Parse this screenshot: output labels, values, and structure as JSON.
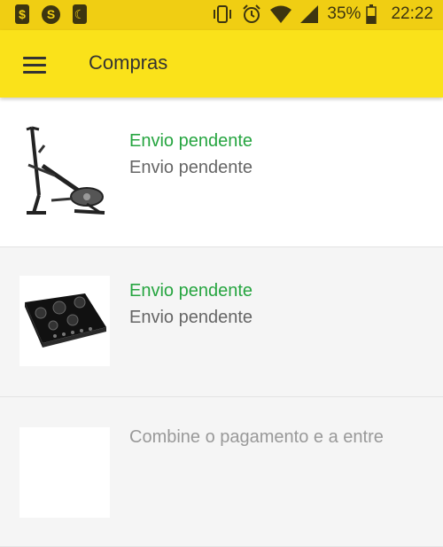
{
  "status_bar": {
    "battery": "35%",
    "time": "22:22",
    "notification_icons": [
      "dollar-notification-icon",
      "s-notification-icon",
      "moon-notification-icon"
    ],
    "status_icons": [
      "vibrate-icon",
      "alarm-icon",
      "wifi-icon",
      "signal-icon",
      "battery-icon"
    ]
  },
  "app_bar": {
    "title": "Compras",
    "menu_icon": "hamburger-menu-icon"
  },
  "orders": [
    {
      "status": "Envio pendente",
      "detail": "Envio pendente",
      "image": "elliptical-trainer"
    },
    {
      "status": "Envio pendente",
      "detail": "Envio pendente",
      "image": "gas-cooktop"
    },
    {
      "status": "Combine o pagamento e a entre"
    }
  ],
  "colors": {
    "status_bar": "#f0ce13",
    "app_bar": "#fae21a",
    "status_green": "#26a540",
    "text_grey": "#666666"
  }
}
